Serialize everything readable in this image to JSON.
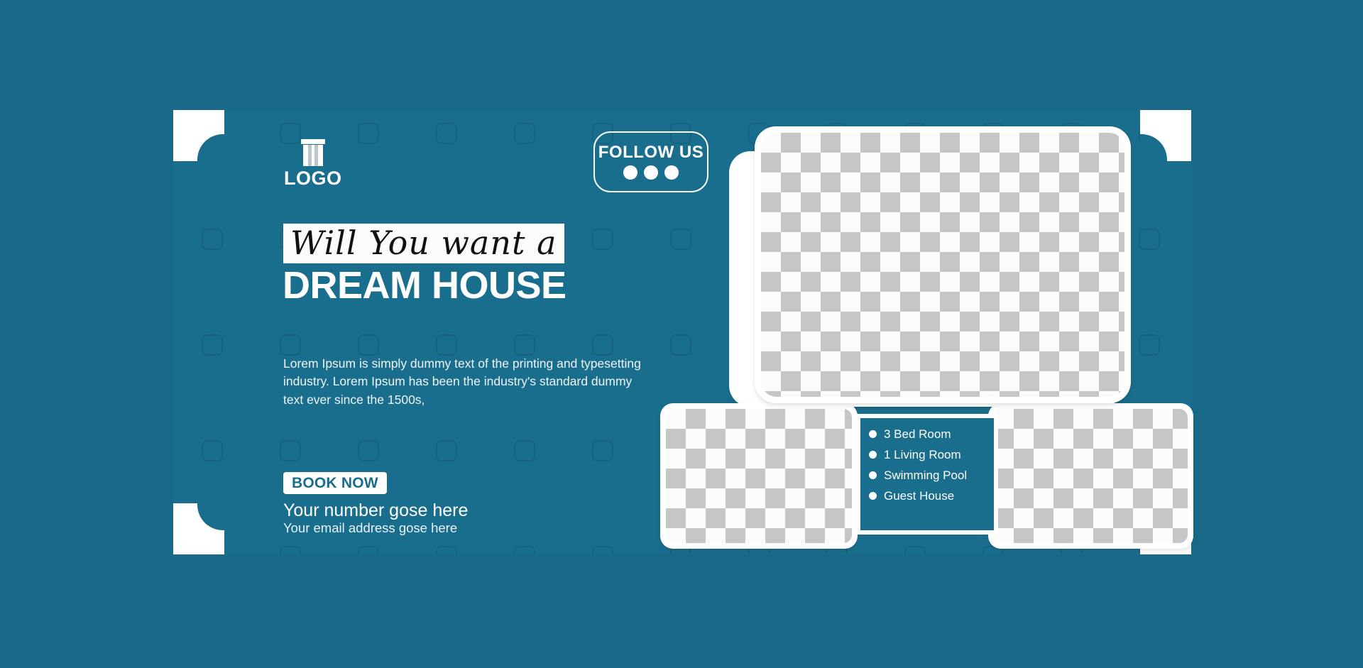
{
  "colors": {
    "background": "#186a88",
    "banner": "#1a6e8d",
    "accent_white": "#ffffff",
    "headline_script_text": "#111111",
    "button_text": "#1a6e8d",
    "placeholder_light": "#fbfbfb",
    "placeholder_dark": "#c6c6c6"
  },
  "brand": {
    "logo_text": "LOGO",
    "logo_icon": "house-icon"
  },
  "follow": {
    "label": "FOLLOW US",
    "dots": 3
  },
  "headline": {
    "script_line": "Will You want a",
    "main_line": "DREAM HOUSE"
  },
  "body": {
    "paragraph": "Lorem Ipsum is simply dummy text of the printing and typesetting industry. Lorem Ipsum has been the industry's standard dummy text ever since the 1500s,"
  },
  "cta": {
    "button_label": "BOOK NOW",
    "phone_line": "Your number gose here",
    "email_line": "Your email address gose here"
  },
  "features": [
    {
      "label": "3 Bed Room"
    },
    {
      "label": "1 Living Room"
    },
    {
      "label": "Swimming Pool"
    },
    {
      "label": "Guest House"
    }
  ],
  "photos": {
    "hero": "image-placeholder",
    "bottom_left": "image-placeholder",
    "bottom_right": "image-placeholder"
  }
}
